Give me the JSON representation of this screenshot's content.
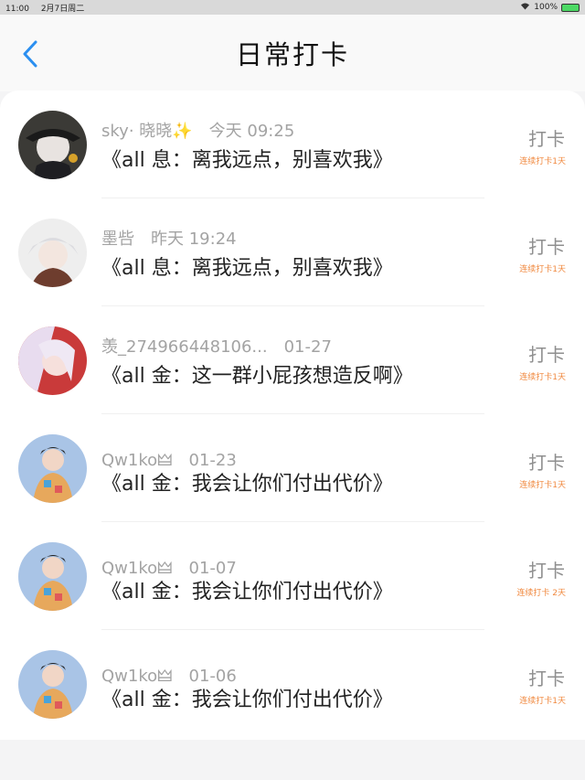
{
  "status": {
    "time": "11:00",
    "date": "2月7日周二",
    "battery": "100%"
  },
  "header": {
    "title": "日常打卡"
  },
  "icons": {
    "back": "chevron-left-icon",
    "wifi": "wifi-icon",
    "battery": "battery-icon"
  },
  "colors": {
    "accent": "#2b8ff0",
    "streak": "#f0883e"
  },
  "rows": [
    {
      "name": "sky· 晓晓✨",
      "time": "今天 09:25",
      "content": "《all 息：离我远点，别喜欢我》",
      "action": "打卡",
      "streak": "连续打卡1天"
    },
    {
      "name": "墨呰",
      "time": "昨天 19:24",
      "content": "《all 息：离我远点，别喜欢我》",
      "action": "打卡",
      "streak": "连续打卡1天"
    },
    {
      "name": "羡_274966448106...",
      "time": "01-27",
      "content": "《all 金：这一群小屁孩想造反啊》",
      "action": "打卡",
      "streak": "连续打卡1天"
    },
    {
      "name": "Qw1ko🜲",
      "time": "01-23",
      "content": "《all 金：我会让你们付出代价》",
      "action": "打卡",
      "streak": "连续打卡1天"
    },
    {
      "name": "Qw1ko🜲",
      "time": "01-07",
      "content": "《all 金：我会让你们付出代价》",
      "action": "打卡",
      "streak": "连续打卡 2天"
    },
    {
      "name": "Qw1ko🜲",
      "time": "01-06",
      "content": "《all 金：我会让你们付出代价》",
      "action": "打卡",
      "streak": "连续打卡1天"
    }
  ]
}
